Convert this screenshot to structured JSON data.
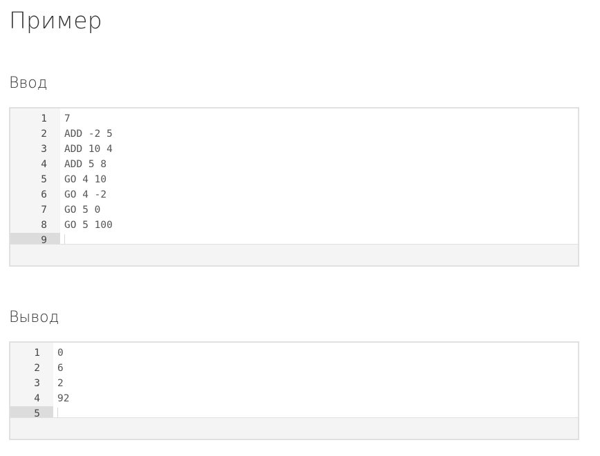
{
  "page": {
    "title": "Пример"
  },
  "input": {
    "title": "Ввод",
    "lines": [
      {
        "num": "1",
        "text": "7"
      },
      {
        "num": "2",
        "text": "ADD -2 5"
      },
      {
        "num": "3",
        "text": "ADD 10 4"
      },
      {
        "num": "4",
        "text": "ADD 5 8"
      },
      {
        "num": "5",
        "text": "GO 4 10"
      },
      {
        "num": "6",
        "text": "GO 4 -2"
      },
      {
        "num": "7",
        "text": "GO 5 0"
      },
      {
        "num": "8",
        "text": "GO 5 100"
      },
      {
        "num": "9",
        "text": ""
      }
    ],
    "active_line": 9
  },
  "output": {
    "title": "Вывод",
    "lines": [
      {
        "num": "1",
        "text": "0"
      },
      {
        "num": "2",
        "text": "6"
      },
      {
        "num": "3",
        "text": "2"
      },
      {
        "num": "4",
        "text": "92"
      },
      {
        "num": "5",
        "text": ""
      }
    ],
    "active_line": 5
  },
  "colors": {
    "text": "#333333",
    "gutter_bg": "#f5f5f5",
    "active_gutter_bg": "#dcdcdc",
    "border": "#e0e0e0",
    "status_bg": "#f4f4f4"
  }
}
